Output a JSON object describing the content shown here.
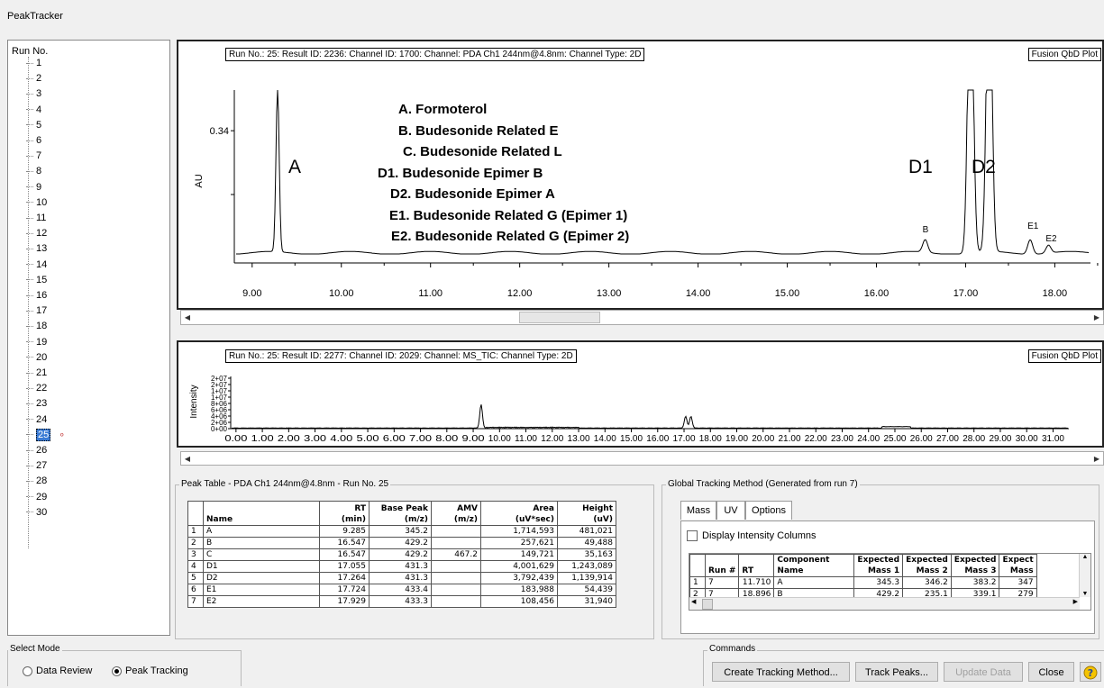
{
  "window": {
    "title": "PeakTracker"
  },
  "tree": {
    "root_label": "Run No.",
    "runs": [
      "1",
      "2",
      "3",
      "4",
      "5",
      "6",
      "7",
      "8",
      "9",
      "10",
      "11",
      "12",
      "13",
      "14",
      "15",
      "16",
      "17",
      "18",
      "19",
      "20",
      "21",
      "22",
      "23",
      "24",
      "25",
      "26",
      "27",
      "28",
      "29",
      "30"
    ],
    "selected_run": "25",
    "selected_marker": "∘"
  },
  "upper_chart": {
    "header": "Run No.: 25: Result ID: 2236: Channel ID: 1700: Channel: PDA Ch1 244nm@4.8nm: Channel Type: 2D",
    "plot_tag": "Fusion QbD Plot",
    "ylabel": "AU",
    "y_tick": "0.34",
    "peak_labels": {
      "A": "A",
      "D1": "D1",
      "D2": "D2",
      "B": "B",
      "E1": "E1",
      "E2": "E2"
    },
    "legend": [
      "A. Formoterol",
      "B. Budesonide Related E",
      "C. Budesonide Related L",
      "D1. Budesonide Epimer B",
      "D2. Budesonide Epimer A",
      "E1. Budesonide Related G (Epimer 1)",
      "E2. Budesonide Related G (Epimer 2)"
    ]
  },
  "lower_chart": {
    "header": "Run No.: 25: Result ID: 2277: Channel ID: 2029: Channel: MS_TIC: Channel Type: 2D",
    "plot_tag": "Fusion QbD Plot",
    "ylabel": "Intensity",
    "y_ticks": [
      "2+07",
      "2+07",
      "1+07",
      "1+07",
      "8+06",
      "6+06",
      "4+06",
      "2+06",
      "0+00"
    ]
  },
  "chart_data": [
    {
      "type": "line",
      "title": "",
      "xlabel": "",
      "ylabel": "AU",
      "xlim": [
        8.8,
        18.4
      ],
      "x_ticks": [
        "9.00",
        "10.00",
        "11.00",
        "12.00",
        "13.00",
        "14.00",
        "15.00",
        "16.00",
        "17.00",
        "18.00"
      ],
      "peaks": [
        {
          "name": "A",
          "x": 9.285,
          "y": 0.45
        },
        {
          "name": "B",
          "x": 16.547,
          "y": 0.035
        },
        {
          "name": "D1",
          "x": 17.055,
          "y": 0.9
        },
        {
          "name": "D2",
          "x": 17.264,
          "y": 0.9
        },
        {
          "name": "E1",
          "x": 17.724,
          "y": 0.04
        },
        {
          "name": "E2",
          "x": 17.929,
          "y": 0.022
        }
      ],
      "ylim": [
        0,
        0.4
      ]
    },
    {
      "type": "line",
      "title": "",
      "xlabel": "",
      "ylabel": "Intensity",
      "xlim": [
        -0.2,
        31.6
      ],
      "x_ticks": [
        "0.00",
        "1.00",
        "2.00",
        "3.00",
        "4.00",
        "5.00",
        "6.00",
        "7.00",
        "8.00",
        "9.00",
        "10.00",
        "11.00",
        "12.00",
        "13.00",
        "14.00",
        "15.00",
        "16.00",
        "17.00",
        "18.00",
        "19.00",
        "20.00",
        "21.00",
        "22.00",
        "23.00",
        "24.00",
        "25.00",
        "26.00",
        "27.00",
        "28.00",
        "29.00",
        "30.00",
        "31.00"
      ],
      "peaks": [
        {
          "x": 9.3,
          "y": 10000000.0
        },
        {
          "x": 17.06,
          "y": 5000000.0
        },
        {
          "x": 17.26,
          "y": 5000000.0
        }
      ],
      "ylim": [
        0,
        22000000.0
      ]
    }
  ],
  "peak_table": {
    "title": "Peak Table - PDA Ch1 244nm@4.8nm - Run No. 25",
    "headers": [
      {
        "l1": "",
        "l2": "Name"
      },
      {
        "l1": "RT",
        "l2": "(min)"
      },
      {
        "l1": "Base Peak",
        "l2": "(m/z)"
      },
      {
        "l1": "AMV",
        "l2": "(m/z)"
      },
      {
        "l1": "Area",
        "l2": "(uV*sec)"
      },
      {
        "l1": "Height",
        "l2": "(uV)"
      }
    ],
    "rows": [
      [
        "1",
        "A",
        "9.285",
        "345.2",
        "",
        "1,714,593",
        "481,021"
      ],
      [
        "2",
        "B",
        "16.547",
        "429.2",
        "",
        "257,621",
        "49,488"
      ],
      [
        "3",
        "C",
        "16.547",
        "429.2",
        "467.2",
        "149,721",
        "35,163"
      ],
      [
        "4",
        "D1",
        "17.055",
        "431.3",
        "",
        "4,001,629",
        "1,243,089"
      ],
      [
        "5",
        "D2",
        "17.264",
        "431.3",
        "",
        "3,792,439",
        "1,139,914"
      ],
      [
        "6",
        "E1",
        "17.724",
        "433.4",
        "",
        "183,988",
        "54,439"
      ],
      [
        "7",
        "E2",
        "17.929",
        "433.3",
        "",
        "108,456",
        "31,940"
      ]
    ]
  },
  "global_tracking": {
    "title": "Global Tracking Method (Generated from run 7)",
    "tabs": [
      "Mass",
      "UV",
      "Options"
    ],
    "display_intensity_label": "Display Intensity Columns",
    "headers": [
      {
        "l1": "",
        "l2": "Run #"
      },
      {
        "l1": "",
        "l2": "RT"
      },
      {
        "l1": "Component",
        "l2": "Name"
      },
      {
        "l1": "Expected",
        "l2": "Mass 1"
      },
      {
        "l1": "Expected",
        "l2": "Mass 2"
      },
      {
        "l1": "Expected",
        "l2": "Mass 3"
      },
      {
        "l1": "Expect",
        "l2": "Mass"
      }
    ],
    "rows": [
      [
        "1",
        "7",
        "11.710",
        "A",
        "345.3",
        "346.2",
        "383.2",
        "347"
      ],
      [
        "2",
        "7",
        "18.896",
        "B",
        "429.2",
        "235.1",
        "339.1",
        "279"
      ]
    ]
  },
  "select_mode": {
    "title": "Select Mode",
    "options": [
      "Data Review",
      "Peak Tracking"
    ],
    "selected": "Peak Tracking"
  },
  "commands": {
    "title": "Commands",
    "buttons": [
      "Create Tracking Method...",
      "Track Peaks...",
      "Update Data",
      "Close"
    ],
    "help_icon_color": "#e8b200"
  }
}
